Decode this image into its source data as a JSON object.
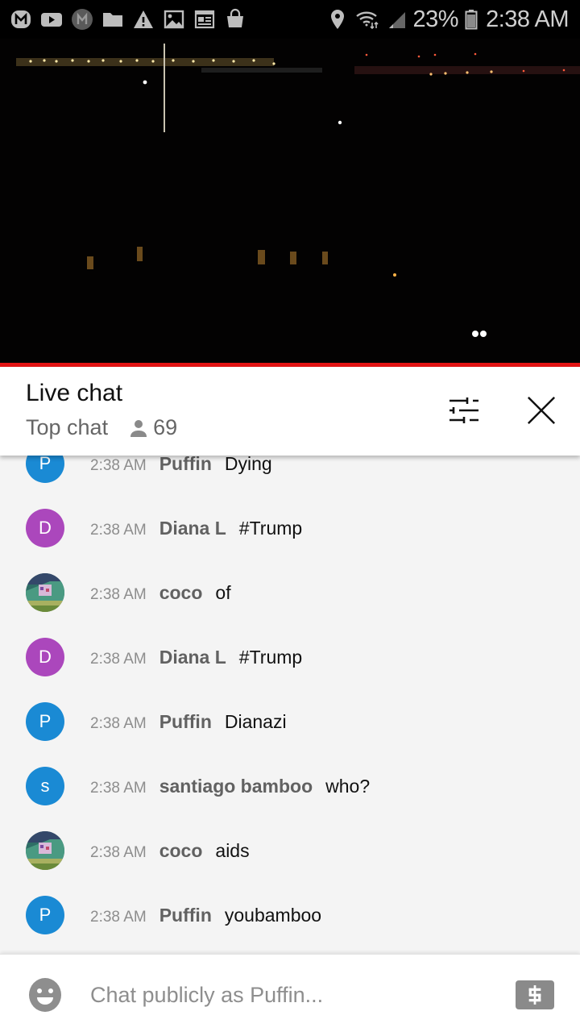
{
  "status_bar": {
    "notification_icons": [
      "m-app-icon",
      "youtube-icon",
      "m-app-dark-icon",
      "folder-icon",
      "warning-icon",
      "image-icon",
      "calendar-news-icon",
      "shopping-bag-icon"
    ],
    "status_icons": [
      "location-icon",
      "wifi-icon",
      "signal-icon",
      "battery-icon"
    ],
    "battery_percent": "23%",
    "time": "2:38 AM"
  },
  "video": {
    "description": "Night-time live stream of distant city lights",
    "progress_fraction": 1.0,
    "progress_color": "#e31414"
  },
  "chat_header": {
    "title": "Live chat",
    "mode_label": "Top chat",
    "viewer_count": "69",
    "filter_icon": "sliders-icon",
    "close_icon": "close-icon"
  },
  "messages": [
    {
      "avatar_type": "letter",
      "avatar_letter": "P",
      "avatar_color": "#1a8ad4",
      "time": "2:38 AM",
      "author": "Puffin",
      "text": "Dying"
    },
    {
      "avatar_type": "letter",
      "avatar_letter": "D",
      "avatar_color": "#ab47bc",
      "time": "2:38 AM",
      "author": "Diana L",
      "text": "#Trump"
    },
    {
      "avatar_type": "photo",
      "avatar_letter": "",
      "avatar_color": "#3d8a78",
      "time": "2:38 AM",
      "author": "coco",
      "text": "of"
    },
    {
      "avatar_type": "letter",
      "avatar_letter": "D",
      "avatar_color": "#ab47bc",
      "time": "2:38 AM",
      "author": "Diana L",
      "text": "#Trump"
    },
    {
      "avatar_type": "letter",
      "avatar_letter": "P",
      "avatar_color": "#1a8ad4",
      "time": "2:38 AM",
      "author": "Puffin",
      "text": "Dianazi"
    },
    {
      "avatar_type": "letter",
      "avatar_letter": "s",
      "avatar_color": "#1a8ad4",
      "time": "2:38 AM",
      "author": "santiago bamboo",
      "text": "who?"
    },
    {
      "avatar_type": "photo",
      "avatar_letter": "",
      "avatar_color": "#3d8a78",
      "time": "2:38 AM",
      "author": "coco",
      "text": "aids"
    },
    {
      "avatar_type": "letter",
      "avatar_letter": "P",
      "avatar_color": "#1a8ad4",
      "time": "2:38 AM",
      "author": "Puffin",
      "text": "youbamboo"
    }
  ],
  "input_bar": {
    "placeholder": "Chat publicly as Puffin...",
    "value": "",
    "emoji_icon": "emoji-icon",
    "superchat_icon": "dollar-icon"
  }
}
